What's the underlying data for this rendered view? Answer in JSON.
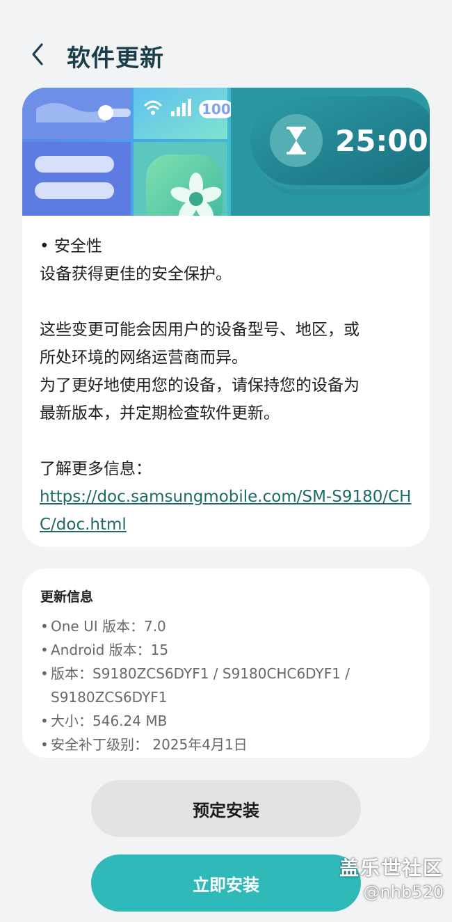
{
  "header": {
    "title": "软件更新",
    "back_icon": "chevron-left-icon"
  },
  "banner": {
    "battery_text": "100",
    "timer": "25:00",
    "timer_icon": "hourglass-icon"
  },
  "notes": {
    "security_title": "• 安全性",
    "security_desc": "设备获得更佳的安全保护。",
    "para1_line1": "这些变更可能会因用户的设备型号、地区，或",
    "para1_line2": "所处环境的网络运营商而异。",
    "para2_line1": "为了更好地使用您的设备，请保持您的设备为",
    "para2_line2": "最新版本，并定期检查软件更新。",
    "more_info_label": "了解更多信息：",
    "more_info_link": "https://doc.samsungmobile.com/SM-S9180/CHC/doc.html"
  },
  "update_info": {
    "title": "更新信息",
    "items": [
      "One UI 版本：7.0",
      "Android 版本：15",
      "版本：S9180ZCS6DYF1 / S9180CHC6DYF1 / S9180ZCS6DYF1",
      "大小：546.24 MB",
      "安全补丁级别： 2025年4月1日"
    ]
  },
  "buttons": {
    "schedule_label": "预定安装",
    "install_label": "立即安装"
  },
  "watermark": {
    "line1": "盖乐世社区",
    "line2": "@nhb520"
  },
  "colors": {
    "accent": "#2fb9b9",
    "title": "#1b3f4a",
    "link": "#1d6a66"
  }
}
